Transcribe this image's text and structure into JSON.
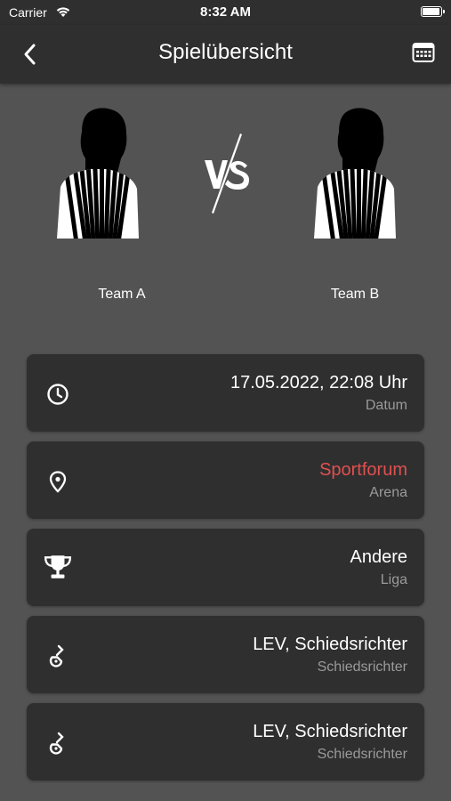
{
  "status_bar": {
    "carrier": "Carrier",
    "time": "8:32 AM"
  },
  "nav": {
    "title": "Spielübersicht",
    "back_icon": "chevron-left-icon",
    "calendar_icon": "calendar-icon"
  },
  "match": {
    "team_a": {
      "name": "Team A",
      "image": "referee-silhouette"
    },
    "team_b": {
      "name": "Team B",
      "image": "referee-silhouette"
    },
    "versus_icon": "vs-icon"
  },
  "details": [
    {
      "icon": "clock-icon",
      "value": "17.05.2022, 22:08 Uhr",
      "label": "Datum"
    },
    {
      "icon": "location-pin-icon",
      "value": "Sportforum",
      "label": "Arena",
      "value_color": "#e0504f"
    },
    {
      "icon": "trophy-icon",
      "value": "Andere",
      "label": "Liga"
    },
    {
      "icon": "whistle-icon",
      "value": "LEV, Schiedsrichter",
      "label": "Schiedsrichter"
    },
    {
      "icon": "whistle-icon",
      "value": "LEV, Schiedsrichter",
      "label": "Schiedsrichter"
    }
  ],
  "colors": {
    "background": "#535353",
    "bar": "#2f2f2f",
    "card": "#2f2f2f",
    "accent": "#e0504f",
    "secondary_text": "#9a9a9a"
  }
}
